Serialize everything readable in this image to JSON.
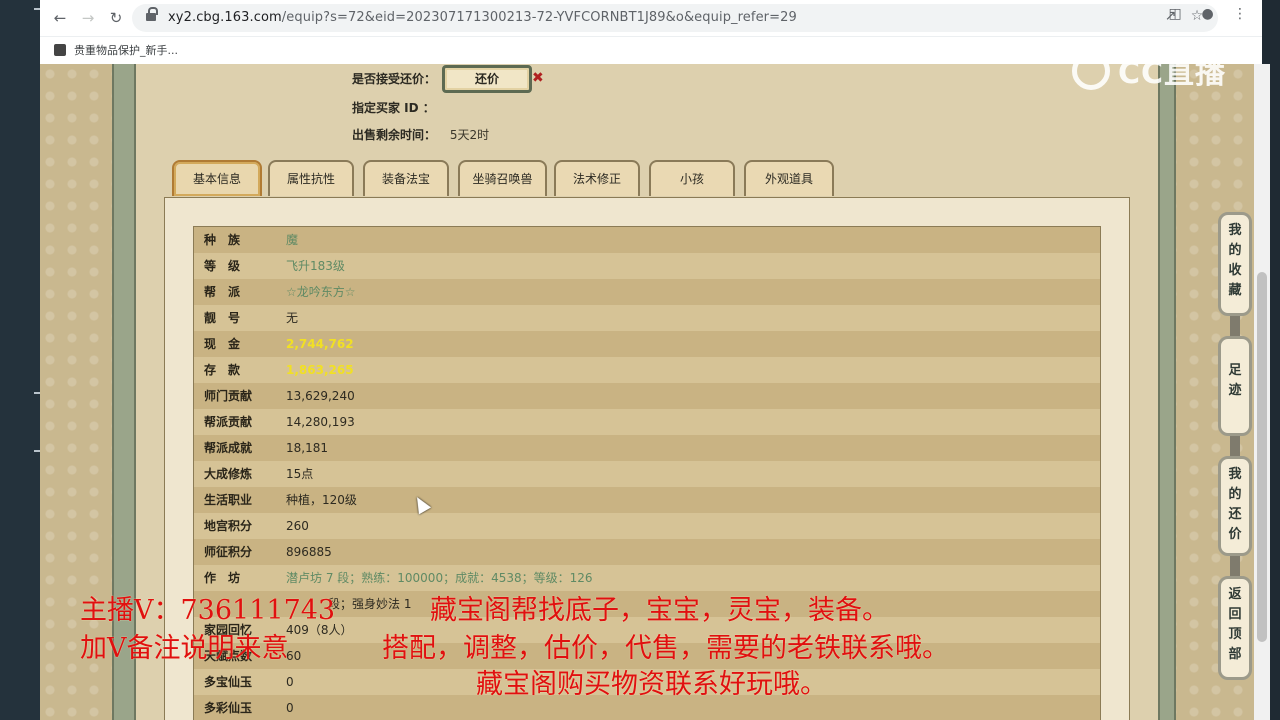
{
  "browser": {
    "url_host": "xy2.cbg.163.com",
    "url_path": "/equip?s=72&eid=202307171300213-72-YVFCORNBT1J89&o&equip_refer=29",
    "bookmark": "贵重物品保护_新手..."
  },
  "sale_info": {
    "accept_counter_label": "是否接受还价：",
    "counter_button": "还价",
    "designated_buyer_label": "指定买家 ID ：",
    "remaining_time_label": "出售剩余时间：",
    "remaining_time_value": "5天2时"
  },
  "tabs": [
    "基本信息",
    "属性抗性",
    "装备法宝",
    "坐骑召唤兽",
    "法术修正",
    "小孩",
    "外观道具"
  ],
  "rows": [
    {
      "key": "种　族",
      "value": "魔"
    },
    {
      "key": "等　级",
      "value": "飞升183级"
    },
    {
      "key": "帮　派",
      "value": "☆龙吟东方☆"
    },
    {
      "key": "靓　号",
      "value": "无"
    },
    {
      "key": "现　金",
      "value": "2,744,762"
    },
    {
      "key": "存　款",
      "value": "1,863,265"
    },
    {
      "key": "师门贡献",
      "value": "13,629,240"
    },
    {
      "key": "帮派贡献",
      "value": "14,280,193"
    },
    {
      "key": "帮派成就",
      "value": "18,181"
    },
    {
      "key": "大成修炼",
      "value": "15点"
    },
    {
      "key": "生活职业",
      "value": "种植，120级"
    },
    {
      "key": "地宫积分",
      "value": "260"
    },
    {
      "key": "师征积分",
      "value": "896885"
    },
    {
      "key": "作　坊",
      "value": "潜卢坊 7 段；熟练：100000；成就：4538；等级：126"
    },
    {
      "key": "",
      "value": "段；强身妙法 1"
    },
    {
      "key": "家园回忆",
      "value": "409（8人）"
    },
    {
      "key": "天赋点数",
      "value": "60"
    },
    {
      "key": "多宝仙玉",
      "value": "0"
    },
    {
      "key": "多彩仙玉",
      "value": "0"
    }
  ],
  "side_buttons": [
    "我的收藏",
    "足迹",
    "我的还价",
    "返回顶部"
  ],
  "watermark": "CC直播",
  "overlay": {
    "line1_left": "主播V：736111743",
    "line1_right": "藏宝阁帮找底子，宝宝，灵宝，装备。",
    "line2_left": "加V备注说明来意",
    "line2_right": "搭配，调整，估价，代售，需要的老铁联系哦。",
    "line3": "藏宝阁购买物资联系好玩哦。"
  },
  "colors": {
    "gold_value": "#f1e024",
    "green_value": "#5f8a64",
    "overlay_red": "#e01010"
  }
}
